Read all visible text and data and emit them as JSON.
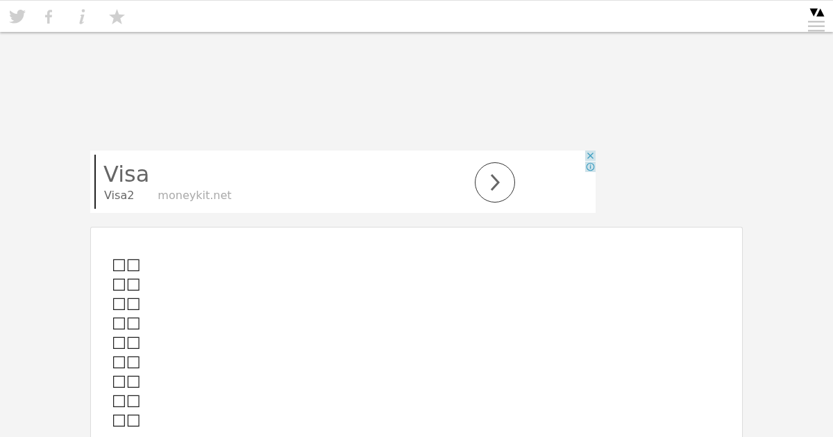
{
  "toolbar": {
    "sort_toggle": "▼▲"
  },
  "ad": {
    "title": "Visa",
    "subtitle": "Visa2",
    "domain": "moneykit.net"
  },
  "content": {
    "lines": [
      "□□",
      "□□",
      "□□",
      "□□",
      "□□",
      "□□",
      "□□",
      "□□",
      "□□"
    ]
  }
}
